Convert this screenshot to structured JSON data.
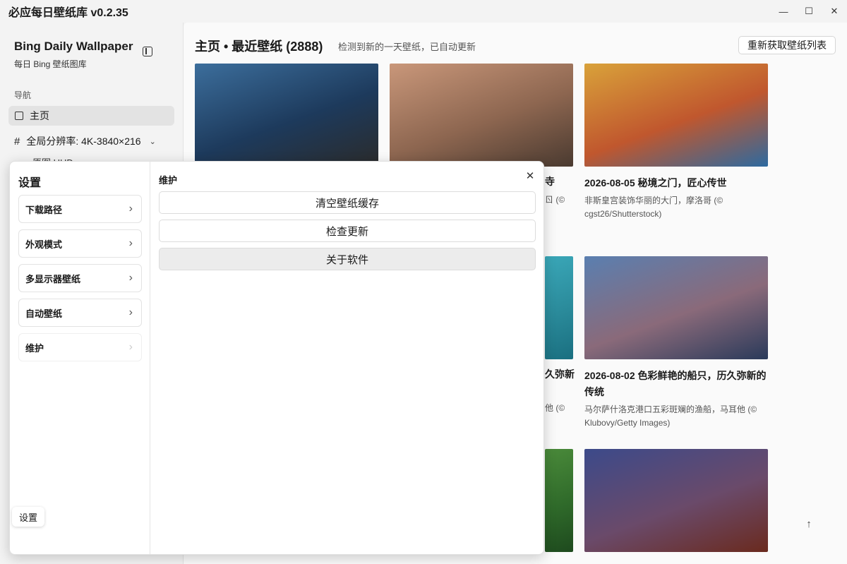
{
  "window": {
    "title": "必应每日壁纸库 v0.2.35",
    "minimize_glyph": "—",
    "maximize_glyph": "☐",
    "close_glyph": "✕"
  },
  "sidebar": {
    "brand_title": "Bing Daily Wallpaper",
    "brand_subtitle": "每日 Bing 壁纸图库",
    "nav_label": "导航",
    "nav_home": "主页",
    "resolution_label": "全局分辨率: 4K-3840×216",
    "resolution_sub": "原图 UHD",
    "settings_button": "设置"
  },
  "main": {
    "title": "主页 • 最近壁纸 (2888)",
    "status": "检测到新的一天壁纸，已自动更新",
    "refresh_button": "重新获取壁纸列表"
  },
  "cards": [
    {
      "title": "",
      "desc": "",
      "colors": [
        "#3c6e9c",
        "#1d3a5c",
        "#2b2b2b"
      ]
    },
    {
      "title": "",
      "desc": "",
      "colors": [
        "#c9977a",
        "#8d6650",
        "#4a3a30"
      ]
    },
    {
      "title": "2026-08-05 秘境之门，匠心传世",
      "desc": "非斯皇宫装饰华丽的大门，摩洛哥 (© cgst26/Shutterstock)",
      "colors": [
        "#d9a23a",
        "#c0572e",
        "#2d6aa0"
      ]
    },
    {
      "title": "",
      "desc": "",
      "colors": [
        "#3aa7b8",
        "#2a8a9a",
        "#1a6f80"
      ]
    },
    {
      "title": "2026-08-02 色彩鲜艳的船只，历久弥新的传统",
      "desc": "马尔萨什洛克港口五彩斑斓的渔船，马耳他 (© Klubovy/Getty Images)",
      "colors": [
        "#5a7fb0",
        "#8a6a7a",
        "#2a3a5a"
      ]
    },
    {
      "title": "",
      "desc": "",
      "colors": [
        "#4a8a3a",
        "#2f6a2a",
        "#1e4a1e"
      ]
    },
    {
      "title": "",
      "desc": "",
      "colors": [
        "#3c4a8a",
        "#6a4a6a",
        "#6a2a1e"
      ]
    }
  ],
  "partial_texts": {
    "t1": "寺",
    "t2": "ㄖ (©",
    "t3": "久弥新",
    "t4": "他 (©"
  },
  "dialog": {
    "title": "设置",
    "menu": [
      {
        "label": "下载路径"
      },
      {
        "label": "外观模式"
      },
      {
        "label": "多显示器壁纸"
      },
      {
        "label": "自动壁纸"
      },
      {
        "label": "维护"
      }
    ],
    "section_title": "维护",
    "actions": [
      {
        "label": "清空壁纸缓存"
      },
      {
        "label": "检查更新"
      },
      {
        "label": "关于软件"
      }
    ],
    "close_glyph": "✕"
  },
  "scroll_top_glyph": "↑"
}
